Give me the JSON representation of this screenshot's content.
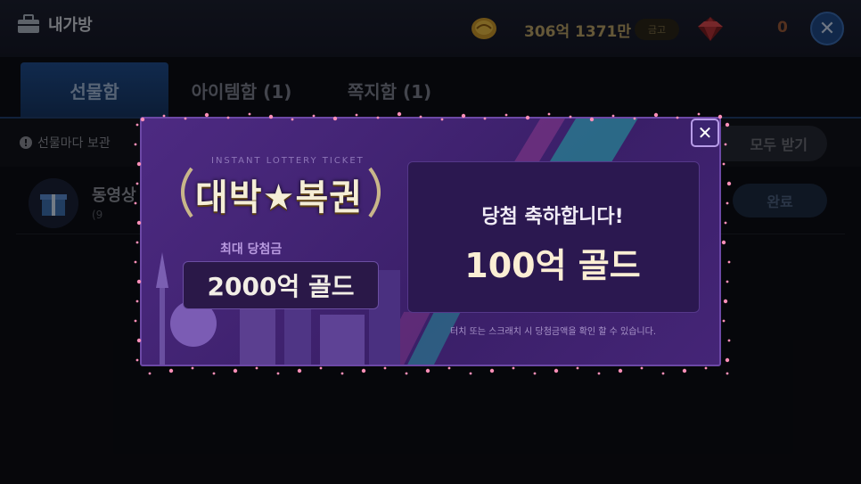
{
  "header": {
    "title": "내가방",
    "gold_amount": "306억 1371만",
    "vault_label": "금고",
    "gem_count": "0",
    "close_symbol": "✕"
  },
  "tabs": [
    {
      "label": "선물함",
      "active": true
    },
    {
      "label": "아이템함 (1)",
      "active": false
    },
    {
      "label": "쪽지함 (1)",
      "active": false
    }
  ],
  "notice": {
    "text": "선물마다 보관",
    "receive_all_label": "모두 받기"
  },
  "gift_list": [
    {
      "title": "동영상",
      "sub": "(9",
      "action_label": "완료"
    }
  ],
  "popup": {
    "subtitle": "INSTANT LOTTERY TICKET",
    "logo_text": "대박★복권",
    "max_prize_label": "최대 당첨금",
    "max_prize": "2000억 골드",
    "congrats": "당첨 축하합니다!",
    "win_amount": "100억 골드",
    "hint": "터치 또는 스크래치 시 당첨금액을 확인 할 수 있습니다.",
    "close_symbol": "✕"
  },
  "colors": {
    "popup_bg": "#4d2a82",
    "tab_active": "#1f4c8c",
    "gold_text": "#b9a067",
    "sparkle": "#ff8fb8"
  },
  "icons": [
    "bag-icon",
    "coin-icon",
    "gem-icon",
    "gift-icon",
    "close-icon",
    "exclamation-icon"
  ]
}
